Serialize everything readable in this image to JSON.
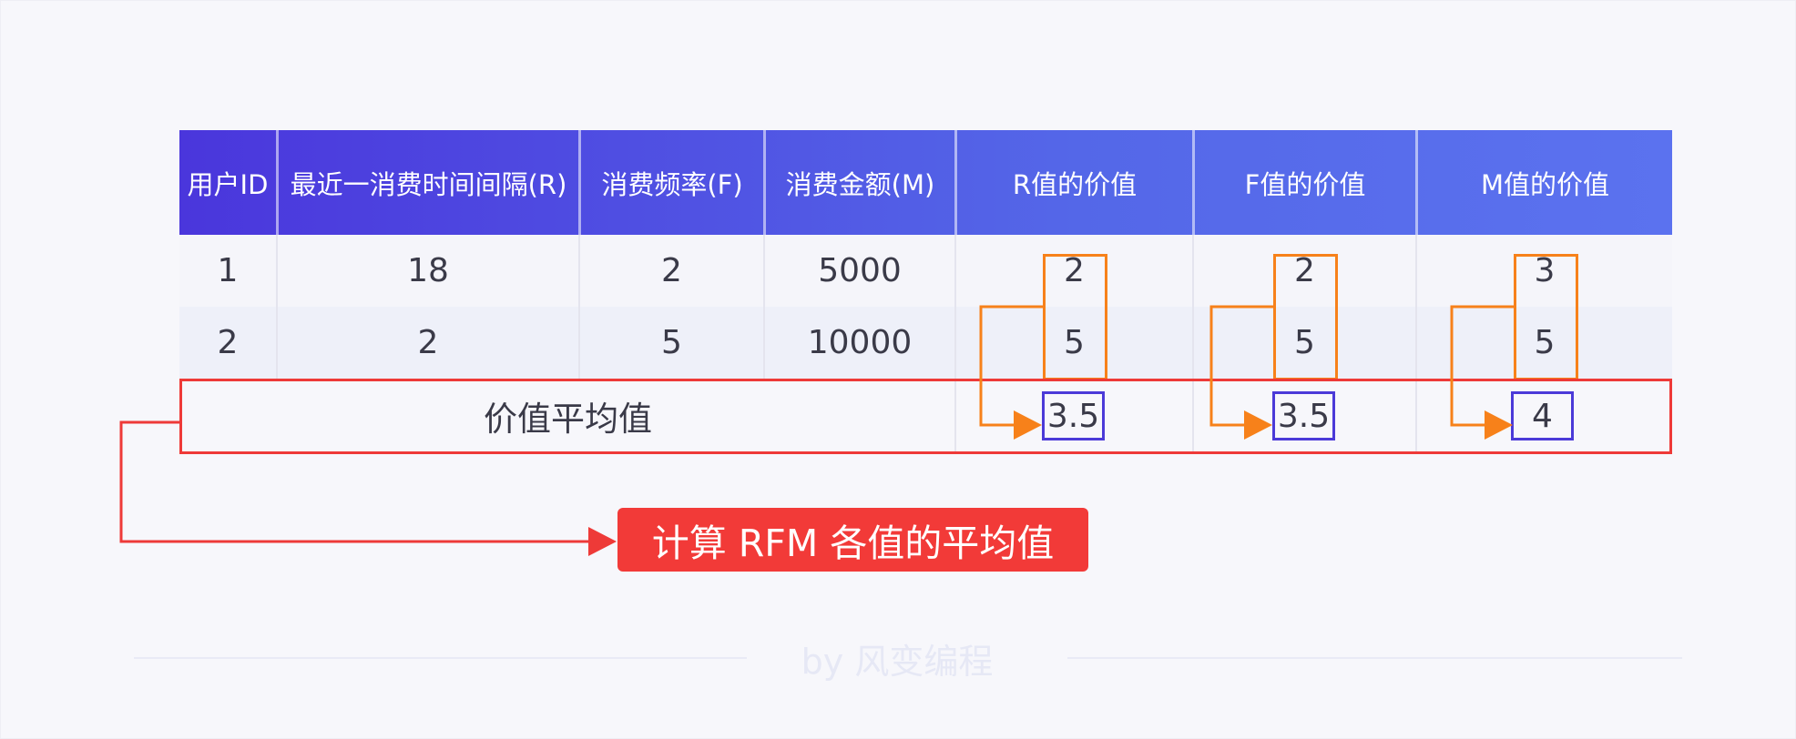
{
  "table": {
    "headers": [
      "用户ID",
      "最近一消费时间间隔(R)",
      "消费频率(F)",
      "消费金额(M)",
      "R值的价值",
      "F值的价值",
      "M值的价值"
    ],
    "rows": [
      [
        "1",
        "18",
        "2",
        "5000",
        "2",
        "2",
        "3"
      ],
      [
        "2",
        "2",
        "5",
        "10000",
        "5",
        "5",
        "5"
      ]
    ],
    "average_row": {
      "label": "价值平均值",
      "values": [
        "3.5",
        "3.5",
        "4"
      ]
    }
  },
  "callout": {
    "text": "计算 RFM 各值的平均值"
  },
  "footer": {
    "credit": "by 风变编程"
  },
  "colors": {
    "header_gradient_start": "#4a36dc",
    "header_gradient_end": "#5b72ef",
    "highlight_red": "#ee3a38",
    "arrow_orange": "#f7811a",
    "value_box_purple": "#4b3ad8",
    "background": "#f7f7fb"
  }
}
